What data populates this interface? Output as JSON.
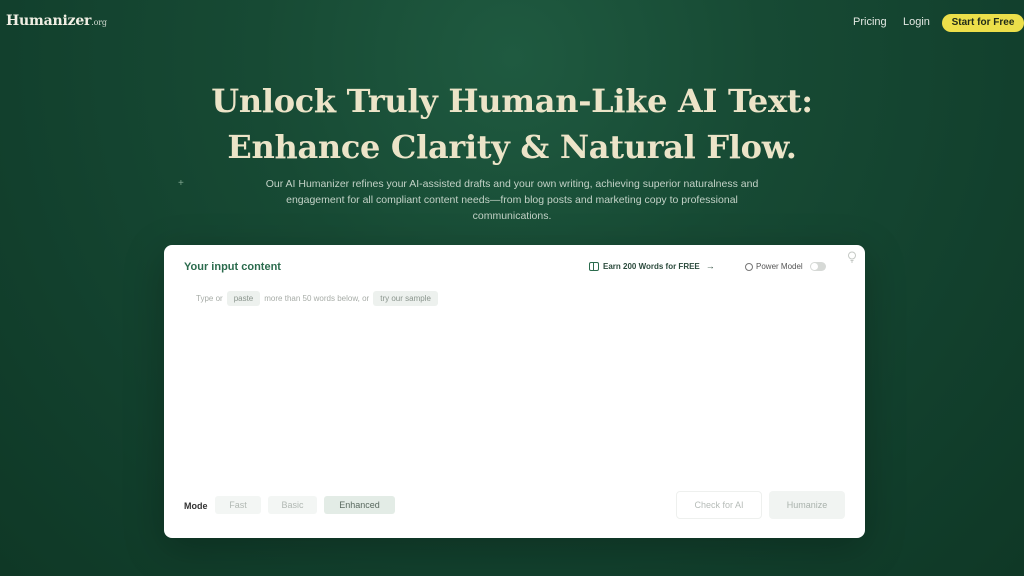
{
  "nav": {
    "logo": "Humanizer",
    "logo_tld": ".org",
    "pricing": "Pricing",
    "login": "Login",
    "cta": "Start for Free"
  },
  "hero": {
    "title_line1": "Unlock Truly Human-Like AI Text:",
    "title_line2": "Enhance Clarity & Natural Flow.",
    "subtitle": "Our AI Humanizer refines your AI-assisted drafts and your own writing, achieving superior naturalness and engagement for all compliant content needs—from blog posts and marketing copy to professional communications."
  },
  "card": {
    "title": "Your input content",
    "earn_label": "Earn 200 Words for FREE",
    "power_model_label": "Power Model",
    "power_model_on": false,
    "hint_prefix": "Type or",
    "hint_paste": "paste",
    "hint_middle": "more than 50 words below, or",
    "hint_sample": "try our sample",
    "mode_label": "Mode",
    "modes": [
      "Fast",
      "Basic",
      "Enhanced"
    ],
    "selected_mode": "Enhanced",
    "check_button": "Check for AI",
    "humanize_button": "Humanize"
  },
  "colors": {
    "background": "#174a34",
    "accent_yellow": "#ecdf4a",
    "title_cream": "#ece4c8",
    "card_accent": "#2b6b4d"
  }
}
